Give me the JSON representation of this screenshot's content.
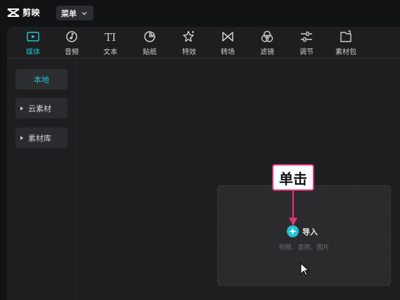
{
  "app": {
    "logo_text": "剪映"
  },
  "titlebar": {
    "menu_label": "菜单"
  },
  "toolbar": {
    "items": [
      {
        "label": "媒体",
        "icon": "media-icon",
        "active": true
      },
      {
        "label": "音频",
        "icon": "audio-icon"
      },
      {
        "label": "文本",
        "icon": "text-icon"
      },
      {
        "label": "贴纸",
        "icon": "sticker-icon"
      },
      {
        "label": "特效",
        "icon": "effects-icon"
      },
      {
        "label": "转场",
        "icon": "transition-icon"
      },
      {
        "label": "滤镜",
        "icon": "filter-icon"
      },
      {
        "label": "调节",
        "icon": "adjust-icon"
      },
      {
        "label": "素材包",
        "icon": "material-pack-icon"
      }
    ],
    "text_icon_glyph": "TI"
  },
  "sidebar": {
    "items": [
      {
        "label": "本地",
        "active": true
      },
      {
        "label": "云素材"
      },
      {
        "label": "素材库"
      }
    ]
  },
  "dropzone": {
    "import_label": "导入",
    "hint": "视频、音频、图片"
  },
  "annotation": {
    "callout": "单击"
  },
  "colors": {
    "accent": "#20c3d0",
    "callout_border": "#e0317a",
    "background": "#1e1e20"
  }
}
